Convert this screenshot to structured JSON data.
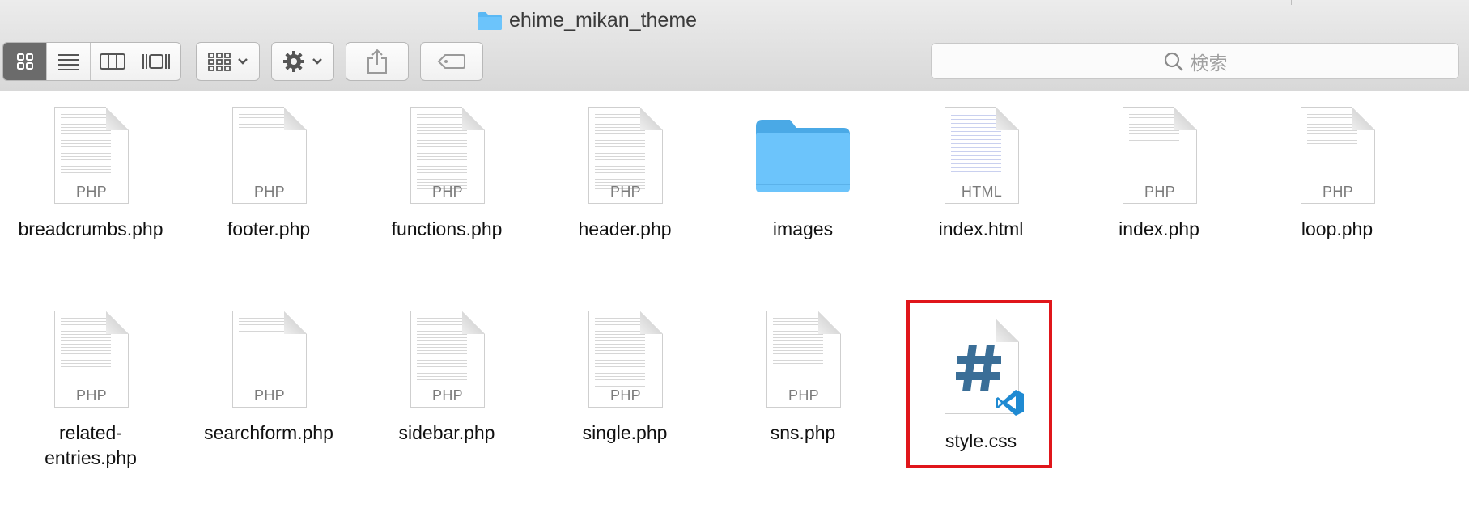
{
  "window": {
    "title": "ehime_mikan_theme"
  },
  "toolbar": {
    "view_buttons": [
      {
        "name": "icon-view",
        "icon": "grid-icon",
        "active": true
      },
      {
        "name": "list-view",
        "icon": "list-icon",
        "active": false
      },
      {
        "name": "column-view",
        "icon": "columns-icon",
        "active": false
      },
      {
        "name": "gallery-view",
        "icon": "gallery-icon",
        "active": false
      }
    ],
    "group_icon": "group-grid-icon",
    "action_icon": "gear-icon",
    "share_icon": "share-icon",
    "tag_icon": "tag-icon"
  },
  "search": {
    "placeholder": "検索"
  },
  "files": [
    {
      "name": "breadcrumbs.php",
      "kind": "PHP",
      "type": "doc"
    },
    {
      "name": "footer.php",
      "kind": "PHP",
      "type": "doc"
    },
    {
      "name": "functions.php",
      "kind": "PHP",
      "type": "doc"
    },
    {
      "name": "header.php",
      "kind": "PHP",
      "type": "doc"
    },
    {
      "name": "images",
      "kind": "",
      "type": "folder"
    },
    {
      "name": "index.html",
      "kind": "HTML",
      "type": "doc"
    },
    {
      "name": "index.php",
      "kind": "PHP",
      "type": "doc"
    },
    {
      "name": "loop.php",
      "kind": "PHP",
      "type": "doc"
    },
    {
      "name": "related-entries.php",
      "name_line1": "related-",
      "name_line2": "entries.php",
      "kind": "PHP",
      "type": "doc"
    },
    {
      "name": "searchform.php",
      "kind": "PHP",
      "type": "doc"
    },
    {
      "name": "sidebar.php",
      "kind": "PHP",
      "type": "doc"
    },
    {
      "name": "single.php",
      "kind": "PHP",
      "type": "doc"
    },
    {
      "name": "sns.php",
      "kind": "PHP",
      "type": "doc"
    },
    {
      "name": "style.css",
      "kind": "",
      "type": "css",
      "selected": true
    }
  ],
  "colors": {
    "folder": "#5ab8f4",
    "highlight_border": "#e0161b",
    "css_hash": "#3a6e97",
    "vscode_blue": "#1f8ad2"
  }
}
